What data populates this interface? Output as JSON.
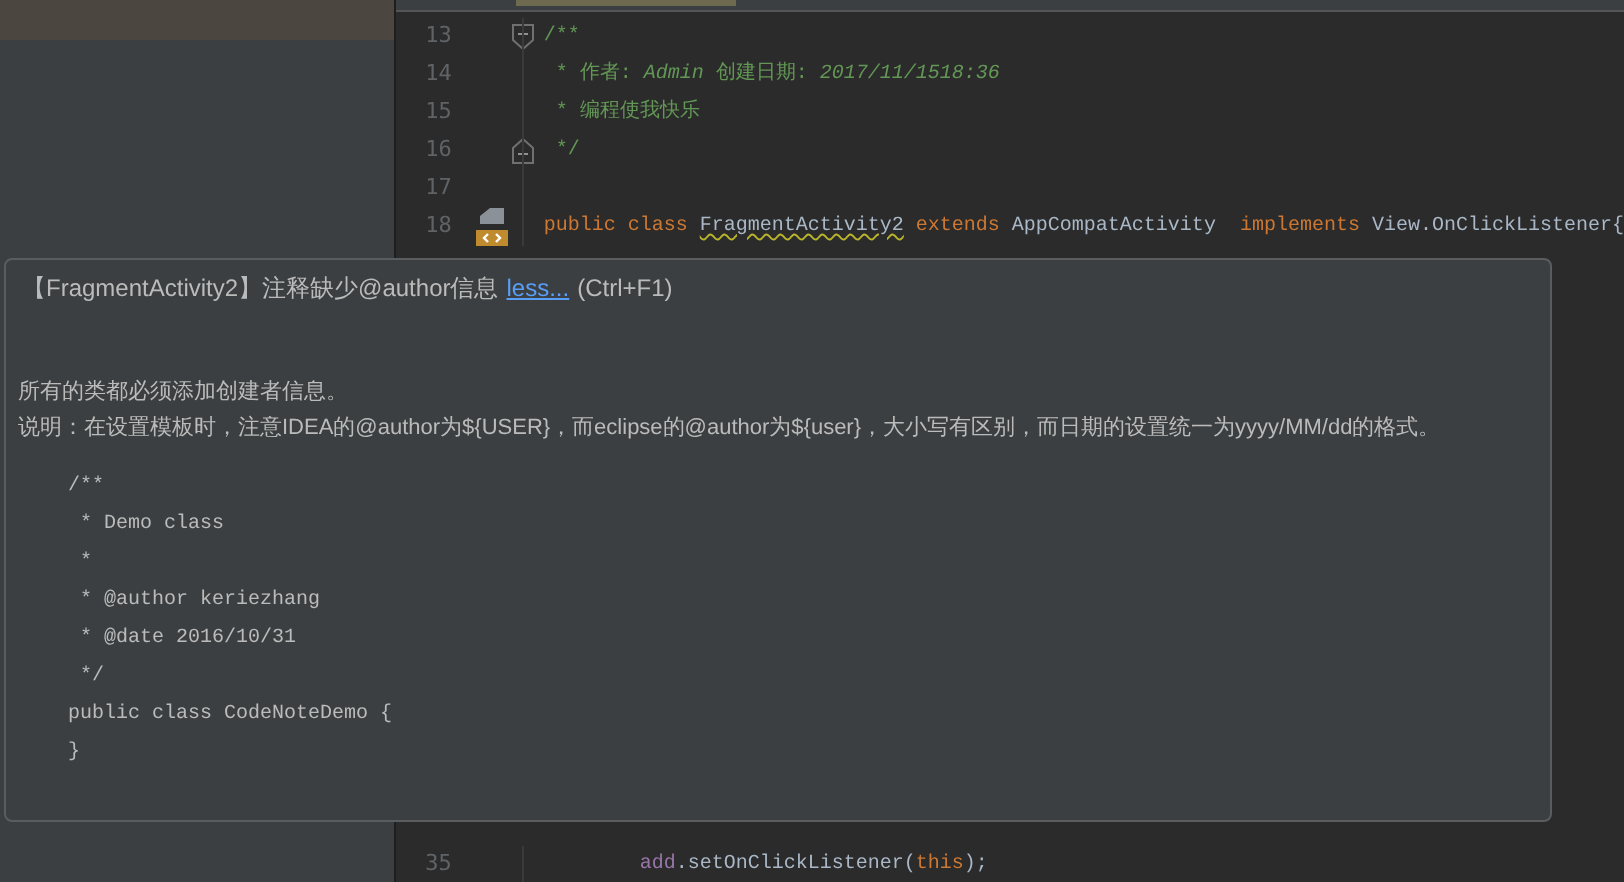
{
  "editor": {
    "lines": [
      {
        "number": "13",
        "fold_start": true,
        "tokens": [
          {
            "text": "/**",
            "kind": "comment"
          }
        ]
      },
      {
        "number": "14",
        "tokens": [
          {
            "text": " * 作者: ",
            "kind": "comment"
          },
          {
            "text": "Admin",
            "kind": "comment_italic"
          },
          {
            "text": " 创建日期: ",
            "kind": "comment"
          },
          {
            "text": "2017/11/1518:36",
            "kind": "comment_italic"
          }
        ]
      },
      {
        "number": "15",
        "tokens": [
          {
            "text": " * 编程使我快乐",
            "kind": "comment"
          }
        ]
      },
      {
        "number": "16",
        "fold_end": true,
        "tokens": [
          {
            "text": " */",
            "kind": "comment"
          }
        ]
      },
      {
        "number": "17"
      },
      {
        "number": "18",
        "gutter_icons": true,
        "tokens": [
          {
            "text": "public class ",
            "kind": "keyword"
          },
          {
            "text": "FragmentActivity2",
            "kind": "warning"
          },
          {
            "text": " extends ",
            "kind": "keyword"
          },
          {
            "text": "AppCompatActivity  ",
            "kind": "plain"
          },
          {
            "text": "implements ",
            "kind": "keyword"
          },
          {
            "text": "View.OnClickListener{",
            "kind": "plain"
          }
        ]
      }
    ],
    "bottom_line": {
      "number": "35",
      "tokens": [
        {
          "text": "        add",
          "kind": "field"
        },
        {
          "text": ".setOnClickListener(",
          "kind": "plain"
        },
        {
          "text": "this",
          "kind": "keyword"
        },
        {
          "text": ");",
          "kind": "plain"
        }
      ]
    }
  },
  "popup": {
    "title": "【FragmentActivity2】注释缺少@author信息",
    "link": "less...",
    "shortcut": "(Ctrl+F1)",
    "description": [
      "所有的类都必须添加创建者信息。",
      "说明：在设置模板时，注意IDEA的@author为${USER}，而eclipse的@author为${user}，大小写有区别，而日期的设置统一为yyyy/MM/dd的格式。"
    ],
    "example": [
      "/**",
      " * Demo class",
      " *",
      " * @author keriezhang",
      " * @date 2016/10/31",
      " */",
      "public class CodeNoteDemo {",
      "}"
    ]
  }
}
